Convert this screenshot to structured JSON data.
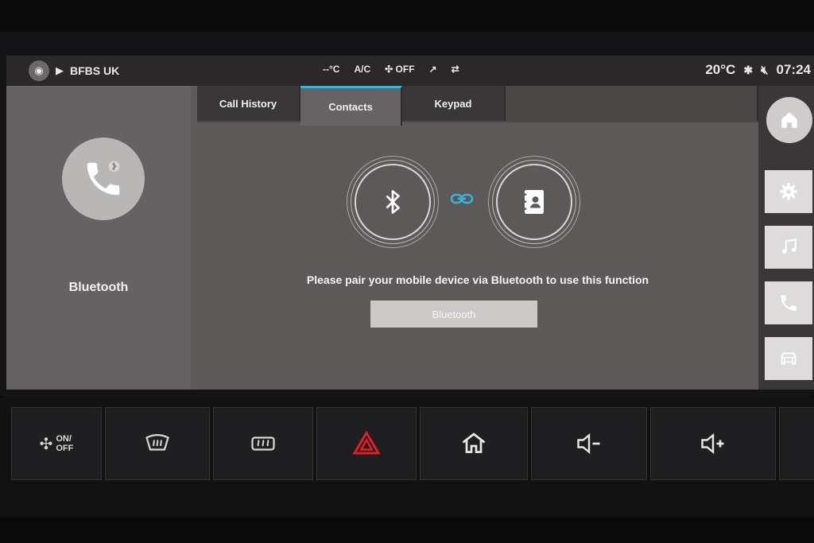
{
  "status_bar": {
    "station": "BFBS UK",
    "temp_setting": "--°C",
    "ac_label": "A/C",
    "fan_label": "OFF",
    "outside_temp": "20°C",
    "time": "07:24"
  },
  "left_panel": {
    "label": "Bluetooth"
  },
  "tabs": [
    {
      "label": "Call History",
      "active": false
    },
    {
      "label": "Contacts",
      "active": true
    },
    {
      "label": "Keypad",
      "active": false
    }
  ],
  "main": {
    "message": "Please pair your mobile device via Bluetooth to use this function",
    "button_label": "Bluetooth"
  },
  "colors": {
    "accent": "#37b5d9",
    "hazard": "#e02020"
  },
  "sidebar_icons": [
    "home-icon",
    "gear-icon",
    "music-icon",
    "phone-icon",
    "car-icon"
  ],
  "hardware_keys": {
    "fan_text_1": "ON/",
    "fan_text_2": "OFF"
  }
}
